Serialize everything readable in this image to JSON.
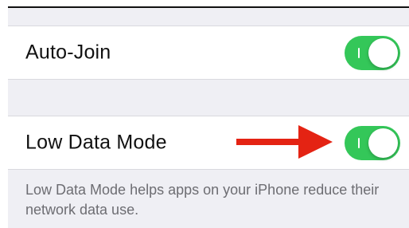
{
  "settings": {
    "auto_join": {
      "label": "Auto-Join",
      "toggle_state": "on"
    },
    "low_data_mode": {
      "label": "Low Data Mode",
      "toggle_state": "on",
      "description": "Low Data Mode helps apps on your iPhone reduce their network data use."
    }
  },
  "colors": {
    "toggle_on": "#34c759",
    "group_background": "#efeff4",
    "annotation_arrow": "#e42313"
  },
  "icons": {
    "annotation": "red-arrow-icon"
  }
}
